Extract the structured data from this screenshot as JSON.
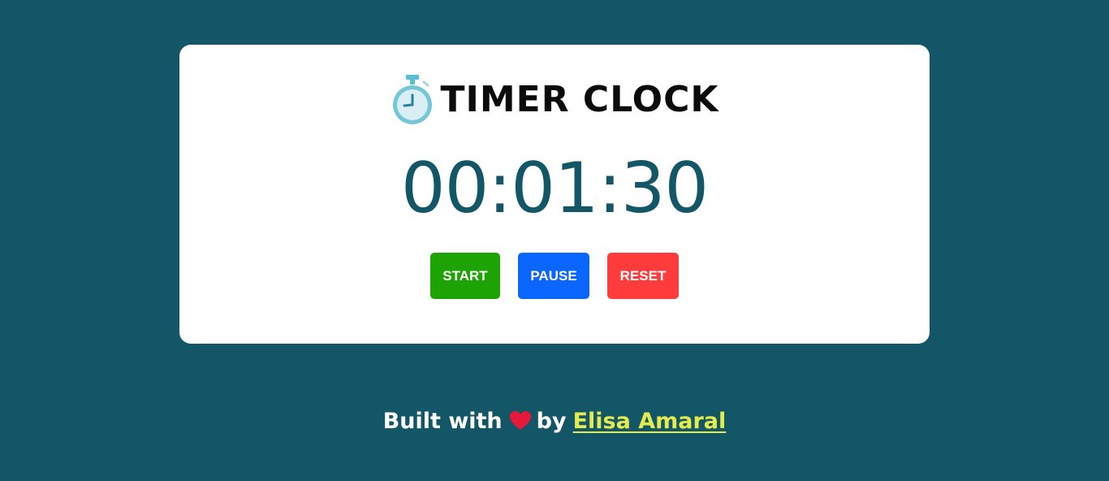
{
  "app": {
    "title": "TIMER CLOCK",
    "icon": "stopwatch-icon"
  },
  "timer": {
    "display": "00:01:30"
  },
  "controls": {
    "start_label": "START",
    "pause_label": "PAUSE",
    "reset_label": "RESET"
  },
  "footer": {
    "built_with": "Built with",
    "heart_icon": "heart-icon",
    "by": "by",
    "author": "Elisa Amaral"
  },
  "colors": {
    "background": "#125667",
    "card": "#ffffff",
    "time_text": "#125667",
    "start": "#1ea305",
    "pause": "#0a66ff",
    "reset": "#ff3b3b",
    "author_link": "#e5ea4d",
    "heart": "#e8173c"
  }
}
